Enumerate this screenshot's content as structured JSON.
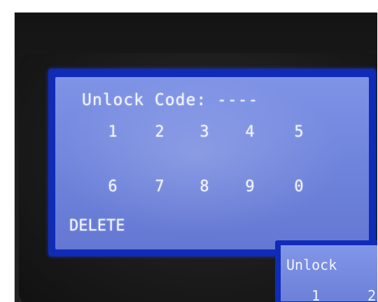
{
  "screen": {
    "title": "Unlock Code: ----",
    "keypad": {
      "row1": [
        "1",
        "2",
        "3",
        "4",
        "5"
      ],
      "row2": [
        "6",
        "7",
        "8",
        "9",
        "0"
      ]
    },
    "delete_label": "DELETE"
  },
  "inset": {
    "title": "Unlock",
    "key1": "1",
    "key2": "2"
  },
  "colors": {
    "lcd_background": "#7083dc",
    "bezel": "#0f2bb8",
    "text": "#f2f4ff"
  }
}
